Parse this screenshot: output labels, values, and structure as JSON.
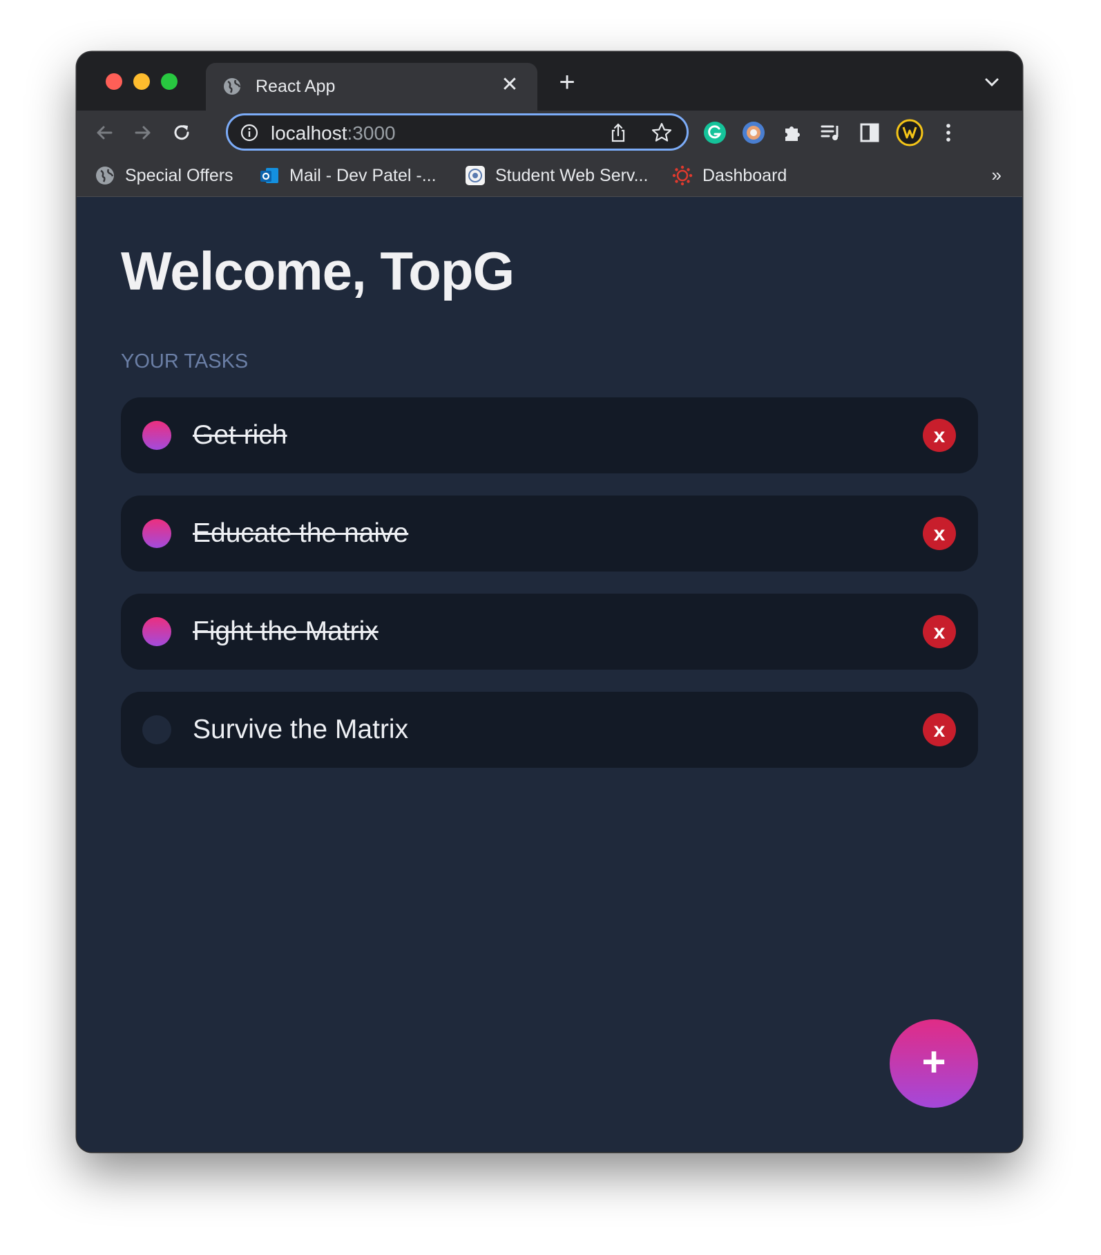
{
  "browser": {
    "tab": {
      "title": "React App",
      "close_glyph": "✕"
    },
    "new_tab_glyph": "+",
    "address": {
      "host": "localhost",
      "port": ":3000"
    },
    "bookmarks": [
      {
        "label": "Special Offers",
        "icon": "globe-icon"
      },
      {
        "label": "Mail - Dev Patel -...",
        "icon": "outlook-icon"
      },
      {
        "label": "Student Web Serv...",
        "icon": "university-seal-icon"
      },
      {
        "label": "Dashboard",
        "icon": "canvas-icon"
      }
    ],
    "bookmarks_more": "»",
    "extensions": [
      "grammarly-icon",
      "tracking-extension-icon",
      "puzzle-icon",
      "reading-list-icon",
      "sidebar-icon",
      "wallet-icon",
      "kebab-menu-icon"
    ],
    "colors": {
      "frame": "#202124",
      "toolbar": "#35363a",
      "omnibox_border": "#7cacf8"
    }
  },
  "app": {
    "greeting": "Welcome, TopG",
    "section_label": "YOUR TASKS",
    "tasks": [
      {
        "text": "Get rich",
        "done": true,
        "delete_label": "x"
      },
      {
        "text": "Educate the naive",
        "done": true,
        "delete_label": "x"
      },
      {
        "text": "Fight the Matrix",
        "done": true,
        "delete_label": "x"
      },
      {
        "text": "Survive the Matrix",
        "done": false,
        "delete_label": "x"
      }
    ],
    "add_button_label": "+",
    "colors": {
      "background": "#1f293b",
      "card": "#131a26",
      "delete": "#c81e2c",
      "accent_start": "#ec2f7f",
      "accent_end": "#a24bdc"
    }
  }
}
